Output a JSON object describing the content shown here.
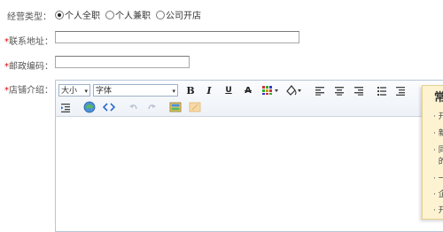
{
  "form": {
    "business_type": {
      "label": "经营类型：",
      "options": [
        {
          "label": "个人全职",
          "checked": true
        },
        {
          "label": "个人兼职",
          "checked": false
        },
        {
          "label": "公司开店",
          "checked": false
        }
      ]
    },
    "address": {
      "required_mark": "*",
      "label": "联系地址：",
      "value": ""
    },
    "postcode": {
      "required_mark": "*",
      "label": "邮政编码：",
      "value": ""
    },
    "store_intro": {
      "required_mark": "*",
      "label": "店铺介绍："
    }
  },
  "editor": {
    "size_select": "大小",
    "font_select": "字体",
    "buttons": {
      "bold": "B",
      "italic": "I",
      "underline": "U",
      "strikethrough": "A"
    },
    "icons": [
      "bold-icon",
      "italic-icon",
      "underline-icon",
      "strikethrough-icon",
      "table-icon",
      "text-color-icon",
      "align-left-icon",
      "align-center-icon",
      "align-right-icon",
      "unordered-list-icon",
      "ordered-list-icon",
      "indent-icon",
      "emoticon-icon",
      "source-code-icon",
      "undo-icon",
      "redo-icon",
      "image-icon",
      "clear-format-icon"
    ]
  },
  "tip_panel": {
    "title": "常",
    "items": [
      "开",
      "新",
      "同",
      "的",
      "一",
      "企",
      "开"
    ]
  }
}
